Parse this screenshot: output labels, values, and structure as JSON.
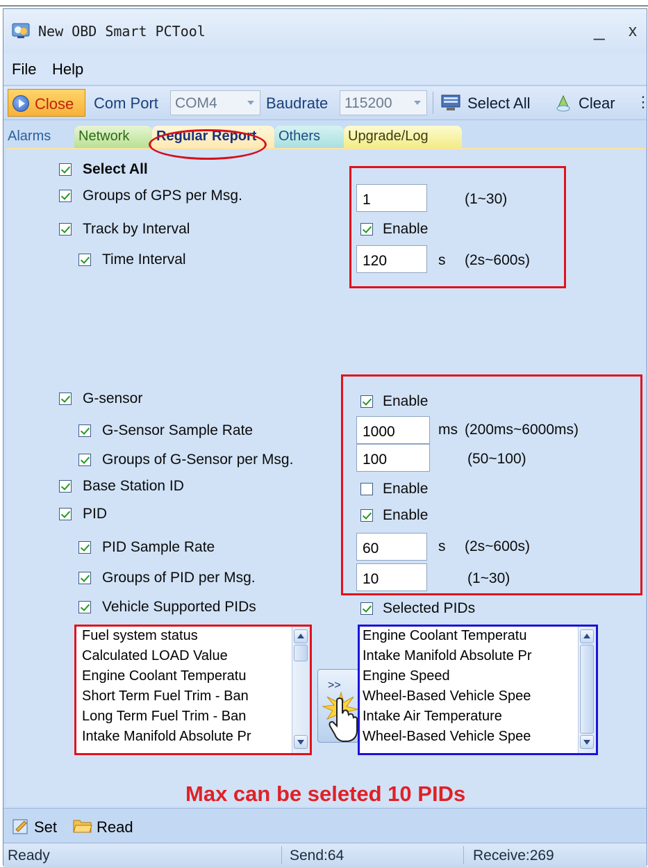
{
  "window": {
    "title": "New OBD Smart PCTool",
    "minimize": "_",
    "close": "x"
  },
  "menu": {
    "file": "File",
    "help": "Help"
  },
  "toolbar": {
    "close_label": "Close",
    "com_port_label": "Com Port",
    "com_port_value": "COM4",
    "baudrate_label": "Baudrate",
    "baudrate_value": "115200",
    "select_all": "Select All",
    "clear": "Clear"
  },
  "tabs": [
    "Alarms",
    "Network",
    "Regular Report",
    "Others",
    "Upgrade/Log"
  ],
  "active_tab": "Regular Report",
  "form": {
    "select_all": "Select All",
    "gps_groups": {
      "label": "Groups of GPS per Msg.",
      "value": "1",
      "range": "(1~30)"
    },
    "track_interval": {
      "label": "Track by Interval",
      "enable": "Enable"
    },
    "time_interval": {
      "label": "Time Interval",
      "value": "120",
      "unit": "s",
      "range": "(2s~600s)"
    },
    "g_sensor": {
      "label": "G-sensor",
      "enable": "Enable"
    },
    "g_sample_rate": {
      "label": "G-Sensor Sample Rate",
      "value": "1000",
      "unit": "ms",
      "range": "(200ms~6000ms)"
    },
    "g_groups": {
      "label": "Groups of G-Sensor per Msg.",
      "value": "100",
      "range": "(50~100)"
    },
    "base_station": {
      "label": "Base Station ID",
      "enable": "Enable"
    },
    "pid": {
      "label": "PID",
      "enable": "Enable"
    },
    "pid_sample_rate": {
      "label": "PID Sample Rate",
      "value": "60",
      "unit": "s",
      "range": "(2s~600s)"
    },
    "pid_groups": {
      "label": "Groups of PID per Msg.",
      "value": "10",
      "range": "(1~30)"
    },
    "vehicle_pids": {
      "label": "Vehicle Supported PIDs"
    },
    "selected_pids": {
      "label": "Selected PIDs"
    }
  },
  "supported_pids": [
    "Fuel system status",
    "Calculated LOAD Value",
    "Engine Coolant Temperatu",
    "Short Term Fuel Trim - Ban",
    "Long Term Fuel Trim - Ban",
    "Intake Manifold Absolute Pr"
  ],
  "selected_pid_list": [
    "Engine Coolant Temperatu",
    "Intake Manifold Absolute Pr",
    "Engine Speed",
    "Wheel-Based Vehicle Spee",
    "Intake Air Temperature",
    "Wheel-Based Vehicle Spee"
  ],
  "move_button": ">>",
  "note": "Max  can be seleted 10 PIDs",
  "actions": {
    "set": "Set",
    "read": "Read"
  },
  "status": {
    "state": "Ready",
    "send": "Send:64",
    "receive": "Receive:269"
  },
  "colors": {
    "annotation_red": "#e1121c",
    "annotation_blue": "#1a14d8",
    "check_green": "#1f9a1f"
  }
}
